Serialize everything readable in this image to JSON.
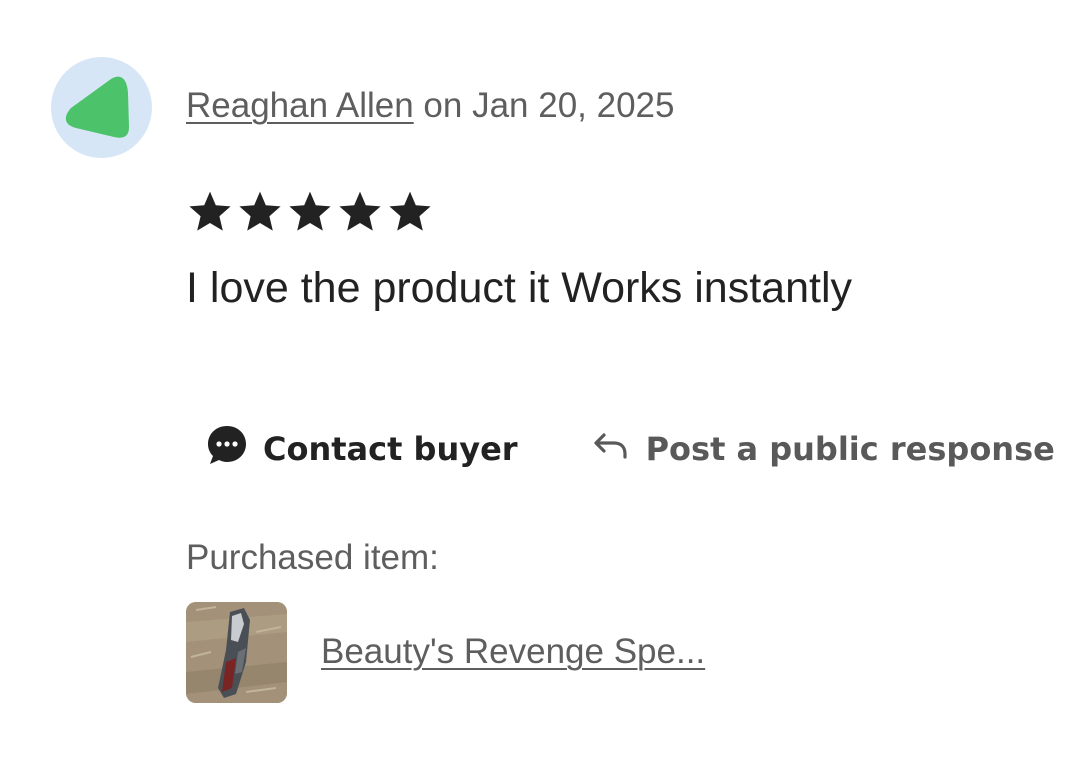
{
  "review": {
    "reviewer_name": "Reaghan Allen",
    "date_text": " on Jan 20, 2025",
    "rating": 5,
    "rating_max": 5,
    "text": "I love the product it Works instantly",
    "avatar_colors": {
      "background": "#d7e6f6",
      "shape": "#4cc26a"
    }
  },
  "actions": {
    "contact_label": "Contact buyer",
    "contact_icon": "chat-bubble-icon",
    "respond_label": "Post a public response",
    "respond_icon": "reply-arrow-icon"
  },
  "purchase": {
    "label": "Purchased item:",
    "item_title": "Beauty's Revenge Spe..."
  }
}
